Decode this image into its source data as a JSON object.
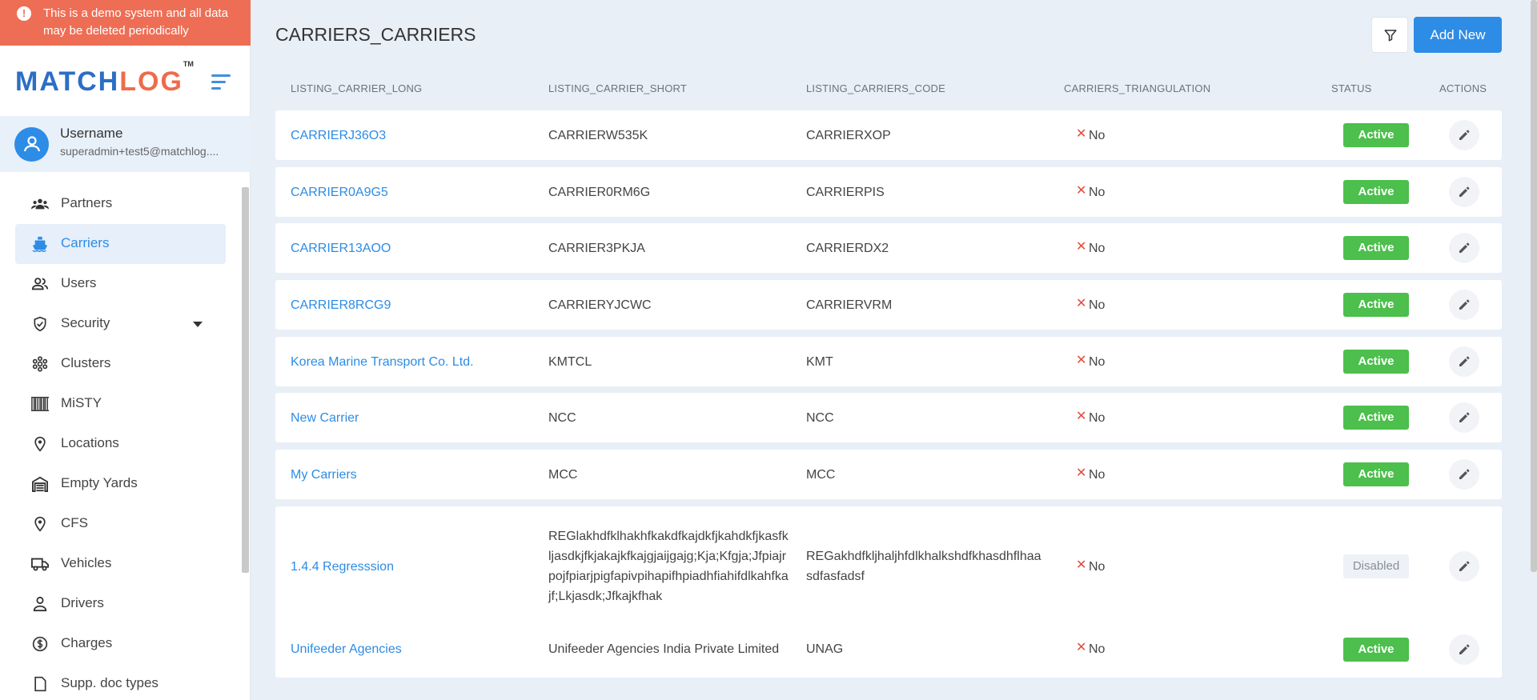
{
  "banner": {
    "text": "This is a demo system and all data may be deleted periodically"
  },
  "brand": {
    "match": "MATCH",
    "log": "LOG",
    "tm": "TM"
  },
  "user": {
    "name": "Username",
    "email": "superadmin+test5@matchlog...."
  },
  "nav": [
    {
      "label": "Partners",
      "icon": "partners-icon"
    },
    {
      "label": "Carriers",
      "icon": "ship-icon",
      "active": true
    },
    {
      "label": "Users",
      "icon": "users-icon"
    },
    {
      "label": "Security",
      "icon": "shield-icon",
      "expandable": true
    },
    {
      "label": "Clusters",
      "icon": "cluster-icon"
    },
    {
      "label": "MiSTY",
      "icon": "barcode-icon"
    },
    {
      "label": "Locations",
      "icon": "location-pin-icon"
    },
    {
      "label": "Empty Yards",
      "icon": "warehouse-icon"
    },
    {
      "label": "CFS",
      "icon": "location-pin-icon"
    },
    {
      "label": "Vehicles",
      "icon": "truck-icon"
    },
    {
      "label": "Drivers",
      "icon": "person-icon"
    },
    {
      "label": "Charges",
      "icon": "dollar-icon"
    },
    {
      "label": "Supp. doc types",
      "icon": "document-icon"
    }
  ],
  "page": {
    "title": "CARRIERS_CARRIERS",
    "add_label": "Add New"
  },
  "table": {
    "headers": {
      "long": "LISTING_CARRIER_LONG",
      "short": "LISTING_CARRIER_SHORT",
      "code": "LISTING_CARRIERS_CODE",
      "tri": "CARRIERS_TRIANGULATION",
      "status": "STATUS",
      "actions": "ACTIONS"
    },
    "rows": [
      {
        "long": "CARRIERJ36O3",
        "short": "CARRIERW535K",
        "code": "CARRIERXOP",
        "tri": "No",
        "status": "Active"
      },
      {
        "long": "CARRIER0A9G5",
        "short": "CARRIER0RM6G",
        "code": "CARRIERPIS",
        "tri": "No",
        "status": "Active"
      },
      {
        "long": "CARRIER13AOO",
        "short": "CARRIER3PKJA",
        "code": "CARRIERDX2",
        "tri": "No",
        "status": "Active"
      },
      {
        "long": "CARRIER8RCG9",
        "short": "CARRIERYJCWC",
        "code": "CARRIERVRM",
        "tri": "No",
        "status": "Active"
      },
      {
        "long": "Korea Marine Transport Co. Ltd.",
        "short": "KMTCL",
        "code": "KMT",
        "tri": "No",
        "status": "Active"
      },
      {
        "long": "New Carrier",
        "short": "NCC",
        "code": "NCC",
        "tri": "No",
        "status": "Active"
      },
      {
        "long": "My Carriers",
        "short": "MCC",
        "code": "MCC",
        "tri": "No",
        "status": "Active"
      },
      {
        "long": "1.4.4 Regresssion",
        "short": "REGlakhdfklhakhfkakdfkajdkfjkahdkfjkasfkljasdkjfkjakajkfkajgjaijgajg;Kja;Kfgja;Jfpiajrpojfpiarjpigfapivpihapifhpiadhfiahifdlkahfkajf;Lkjasdk;Jfkajkfhak",
        "code": "REGakhdfkljhaljhfdlkhalkshdfkhasdhflhaasdfasfadsf",
        "tri": "No",
        "status": "Disabled"
      },
      {
        "long": "Unifeeder Agencies",
        "short": "Unifeeder Agencies India Private Limited",
        "code": "UNAG",
        "tri": "No",
        "status": "Active"
      }
    ]
  }
}
